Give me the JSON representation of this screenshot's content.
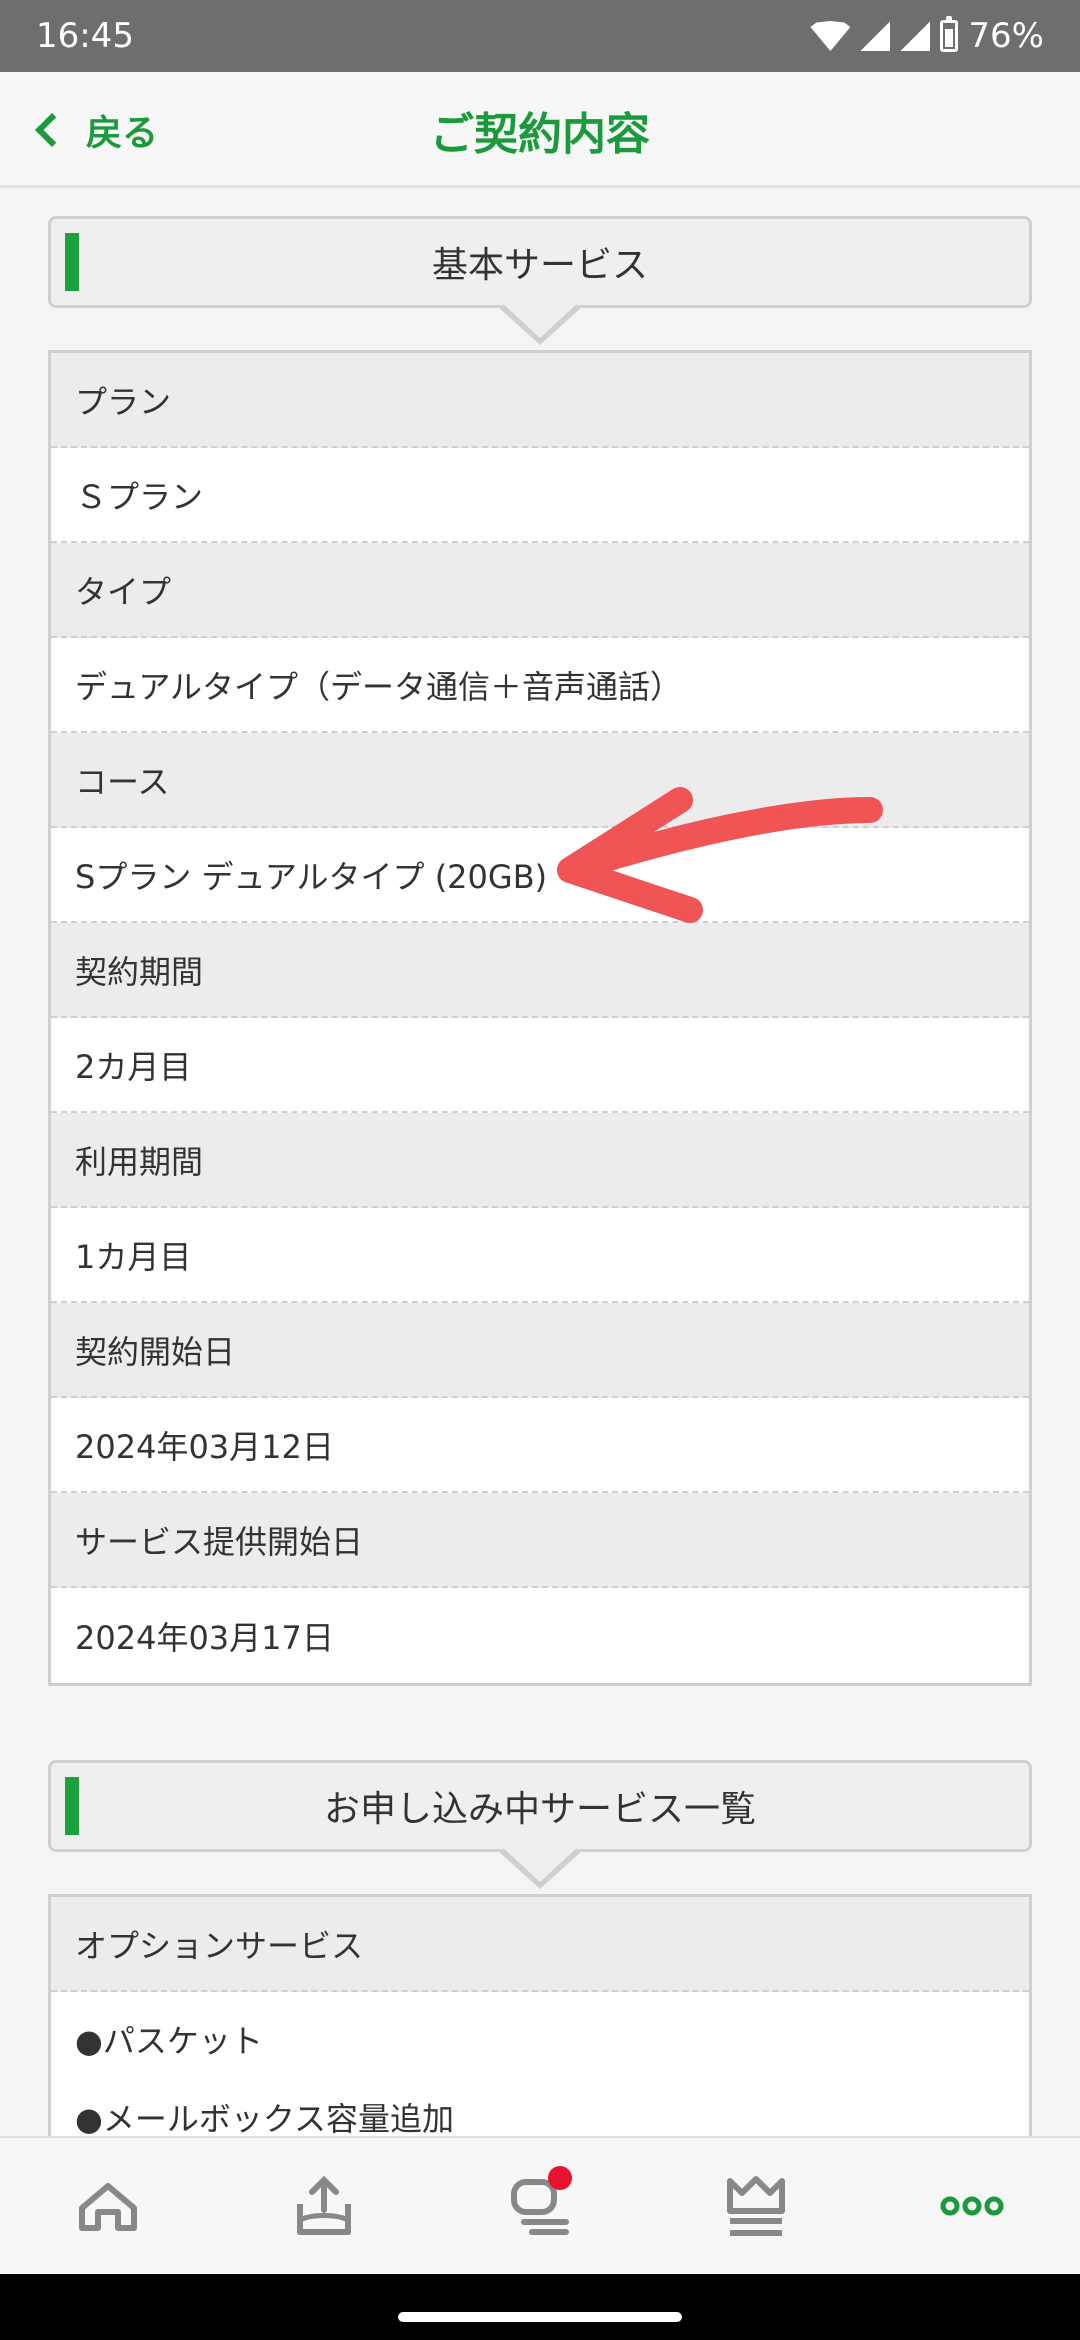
{
  "status": {
    "time": "16:45",
    "battery": "76%"
  },
  "header": {
    "back_label": "戻る",
    "title": "ご契約内容"
  },
  "basic_section": {
    "title": "基本サービス",
    "rows": [
      {
        "label": "プラン",
        "value": "Ｓプラン"
      },
      {
        "label": "タイプ",
        "value": "デュアルタイプ（データ通信＋音声通話）"
      },
      {
        "label": "コース",
        "value": "Sプラン デュアルタイプ (20GB)"
      },
      {
        "label": "契約期間",
        "value": "2カ月目"
      },
      {
        "label": "利用期間",
        "value": "1カ月目"
      },
      {
        "label": "契約開始日",
        "value": "2024年03月12日"
      },
      {
        "label": "サービス提供開始日",
        "value": "2024年03月17日"
      }
    ]
  },
  "applying_section": {
    "title": "お申し込み中サービス一覧",
    "option_label": "オプションサービス",
    "items": [
      "●パスケット",
      "●メールボックス容量追加"
    ]
  },
  "bottom_nav": {
    "items": [
      "home-icon",
      "upload-icon",
      "chat-icon",
      "crown-icon",
      "more-icon"
    ],
    "active_color": "#1a9a3a",
    "badge_color": "#e8122f"
  },
  "annotation": {
    "arrow_color": "#f05454"
  }
}
